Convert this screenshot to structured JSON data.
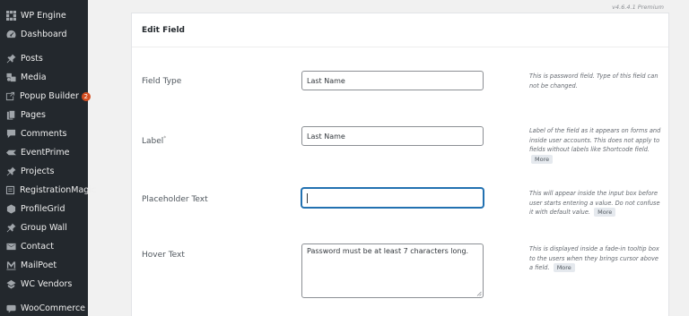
{
  "sidebar": {
    "items": [
      {
        "label": "WP Engine",
        "icon": "wp-engine-icon"
      },
      {
        "label": "Dashboard",
        "icon": "dashboard-icon"
      },
      {
        "label": "Posts",
        "icon": "pin-icon"
      },
      {
        "label": "Media",
        "icon": "media-icon"
      },
      {
        "label": "Popup Builder",
        "icon": "popup-icon",
        "badge": "2"
      },
      {
        "label": "Pages",
        "icon": "pages-icon"
      },
      {
        "label": "Comments",
        "icon": "comment-icon"
      },
      {
        "label": "EventPrime",
        "icon": "event-icon"
      },
      {
        "label": "Projects",
        "icon": "pin-icon"
      },
      {
        "label": "RegistrationMagic",
        "icon": "registration-icon"
      },
      {
        "label": "ProfileGrid",
        "icon": "profilegrid-icon"
      },
      {
        "label": "Group Wall",
        "icon": "pin-icon"
      },
      {
        "label": "Contact",
        "icon": "mail-icon"
      },
      {
        "label": "MailPoet",
        "icon": "mailpoet-icon"
      },
      {
        "label": "WC Vendors",
        "icon": "vendors-icon"
      },
      {
        "label": "WooCommerce",
        "icon": "woocommerce-icon"
      }
    ]
  },
  "version": "v4.6.4.1 Premium",
  "panel": {
    "title": "Edit Field",
    "fields": {
      "field_type": {
        "label": "Field Type",
        "value": "Last Name",
        "help": "This is password field. Type of this field can not be changed."
      },
      "label": {
        "label": "Label",
        "required_mark": "*",
        "value": "Last Name",
        "help": "Label of the field as it appears on forms and inside user accounts. This does not apply to fields without labels like Shortcode field.",
        "more": "More"
      },
      "placeholder": {
        "label": "Placeholder Text",
        "value": "",
        "help": "This will appear inside the input box before user starts entering a value. Do not confuse it with default value.",
        "more": "More"
      },
      "hover": {
        "label": "Hover Text",
        "value": "Password must be at least 7 characters long.",
        "help": "This is displayed inside a fade-in tooltip box to the users when they brings cursor above a field.",
        "more": "More"
      }
    }
  },
  "colors": {
    "sidebar_bg": "#23282d",
    "focus": "#2271b1",
    "badge": "#d54e21"
  }
}
